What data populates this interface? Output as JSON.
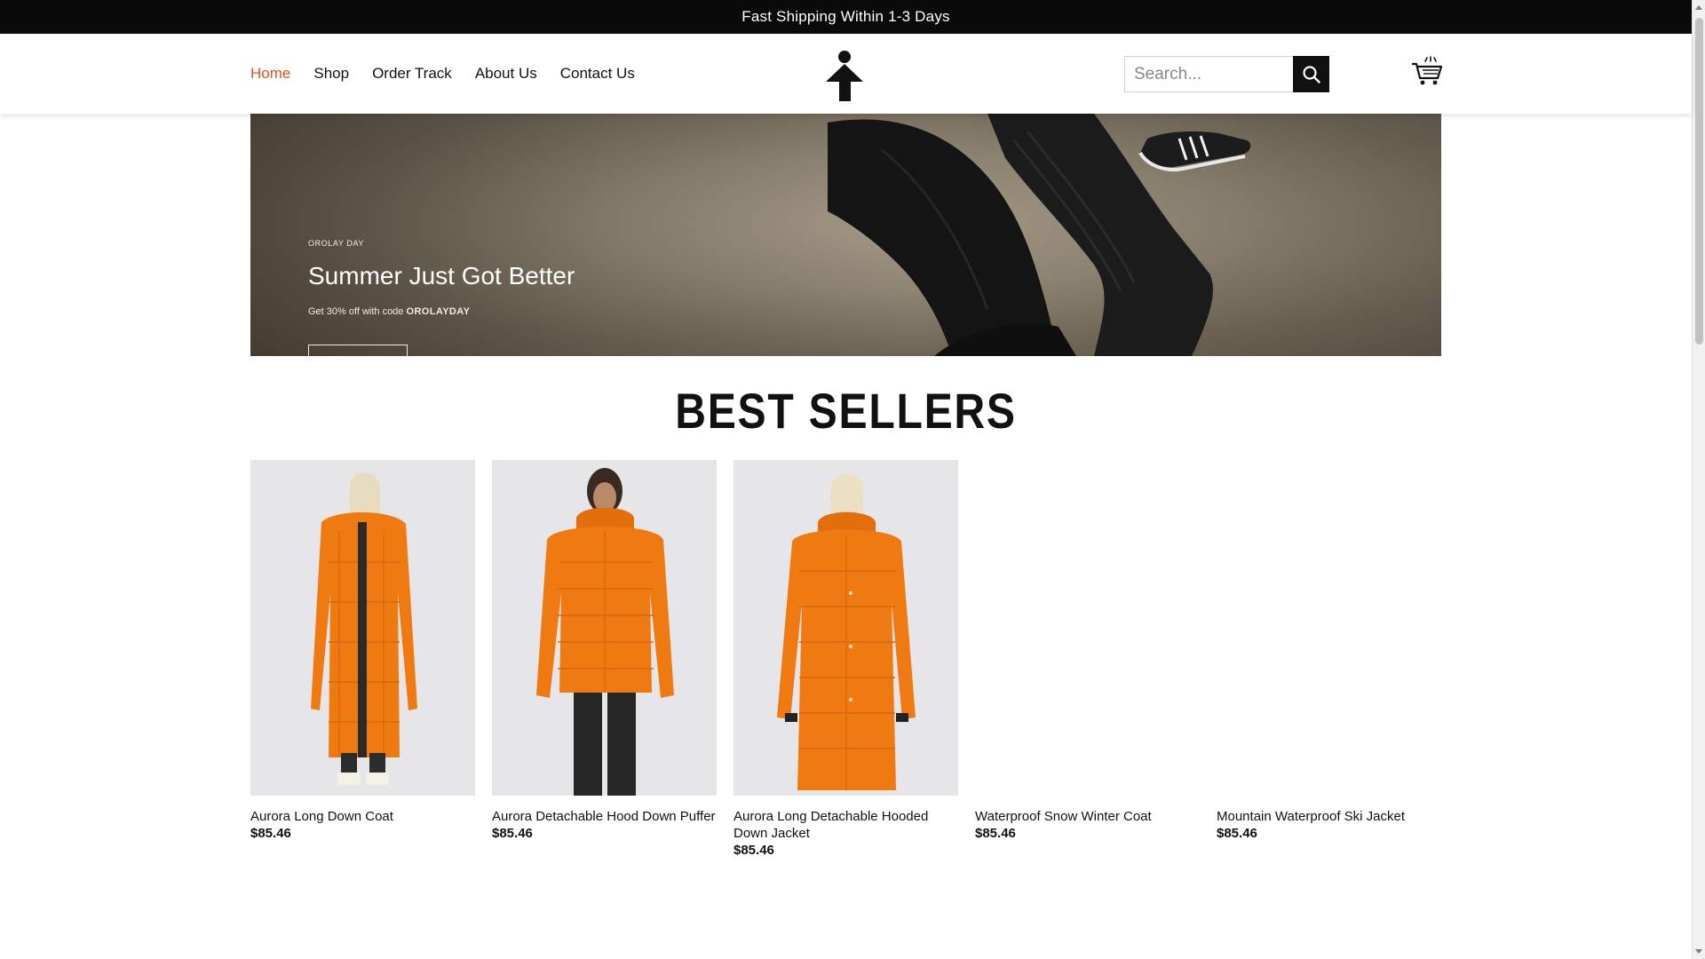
{
  "announcement": "Fast Shipping Within 1-3 Days",
  "nav": {
    "items": [
      {
        "label": "Home",
        "active": true
      },
      {
        "label": "Shop",
        "active": false
      },
      {
        "label": "Order Track",
        "active": false
      },
      {
        "label": "About Us",
        "active": false
      },
      {
        "label": "Contact Us",
        "active": false
      }
    ]
  },
  "logo_icon": "person-arrow-logo",
  "search": {
    "placeholder": "Search...",
    "icon": "search-icon"
  },
  "cart_icon": "shopping-cart-icon",
  "hero": {
    "eyebrow": "OROLAY DAY",
    "headline": "Summer Just Got Better",
    "sub_prefix": "Get 30% off with code ",
    "code": "OROLAYDAY"
  },
  "section_title": "BEST SELLERS",
  "products": [
    {
      "name": "Aurora Long Down Coat",
      "price": "$85.46",
      "image": "orange-long-coat",
      "has_image": true
    },
    {
      "name": "Aurora Detachable Hood Down Puffer",
      "price": "$85.46",
      "image": "orange-puffer",
      "has_image": true
    },
    {
      "name": "Aurora Long Detachable Hooded Down Jacket",
      "price": "$85.46",
      "image": "orange-hooded-long",
      "has_image": true
    },
    {
      "name": "Waterproof Snow Winter Coat",
      "price": "$85.46",
      "image": "",
      "has_image": false
    },
    {
      "name": "Mountain Waterproof Ski Jacket",
      "price": "$85.46",
      "image": "",
      "has_image": false
    }
  ],
  "colors": {
    "accent": "#e8501c",
    "topbar": "#0a0a0a",
    "coat_orange": "#f07a12"
  }
}
